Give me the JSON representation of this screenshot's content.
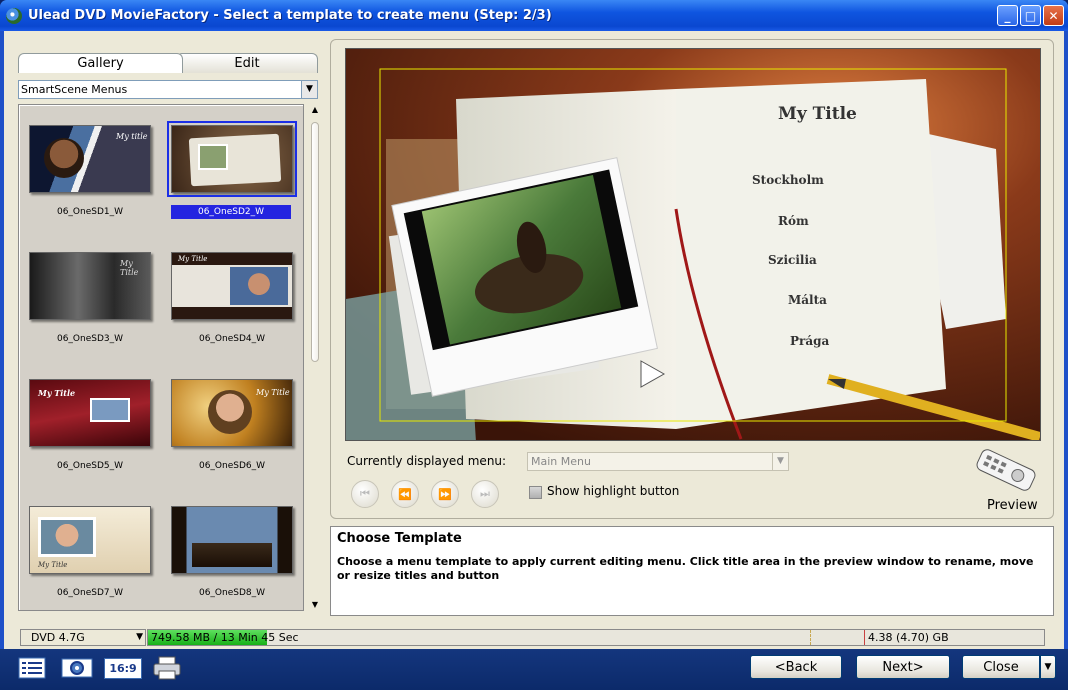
{
  "window": {
    "title": "Ulead DVD MovieFactory - Select a template to create menu (Step: 2/3)",
    "minimize_glyph": "_",
    "maximize_glyph": "□",
    "close_glyph": "✕"
  },
  "left": {
    "tabs": [
      "Gallery",
      "Edit"
    ],
    "category": "SmartScene Menus",
    "thumbnails": [
      {
        "label": "06_OneSD1_W",
        "selected": false
      },
      {
        "label": "06_OneSD2_W",
        "selected": true
      },
      {
        "label": "06_OneSD3_W",
        "selected": false
      },
      {
        "label": "06_OneSD4_W",
        "selected": false
      },
      {
        "label": "06_OneSD5_W",
        "selected": false
      },
      {
        "label": "06_OneSD6_W",
        "selected": false
      },
      {
        "label": "06_OneSD7_W",
        "selected": false
      },
      {
        "label": "06_OneSD8_W",
        "selected": false
      }
    ],
    "thumb_titles": {
      "t1": "My title",
      "t3": "My Title",
      "t4": "My Title",
      "t5": "My Title",
      "t6": "My Title",
      "t7": "My Title"
    }
  },
  "preview": {
    "menu_title": "My Title",
    "menu_items": [
      "Stockholm",
      "Róm",
      "Szicilia",
      "Málta",
      "Prága"
    ],
    "current_menu_label": "Currently displayed menu:",
    "current_menu_value": "Main Menu",
    "show_highlight_label": "Show highlight button",
    "preview_label": "Preview",
    "nav_glyphs": [
      "⏮",
      "⏪",
      "⏩",
      "⏭"
    ]
  },
  "description": {
    "title": "Choose Template",
    "text": "Choose a menu template to apply current editing menu. Click title area in the preview window to rename, move or resize titles and button"
  },
  "status": {
    "disc": "DVD 4.7G",
    "used": "749.58 MB / 13 Min 45 Sec",
    "used_fraction": 0.133,
    "capacity": "4.38 (4.70) GB"
  },
  "buttons": {
    "back": "<Back",
    "next": "Next>",
    "close": "Close",
    "aspect": "16:9"
  },
  "colors": {
    "title_bar": "#0f55e0",
    "bottom_bar": "#14367e",
    "selection": "#2424e0",
    "progress": "#18b018"
  }
}
